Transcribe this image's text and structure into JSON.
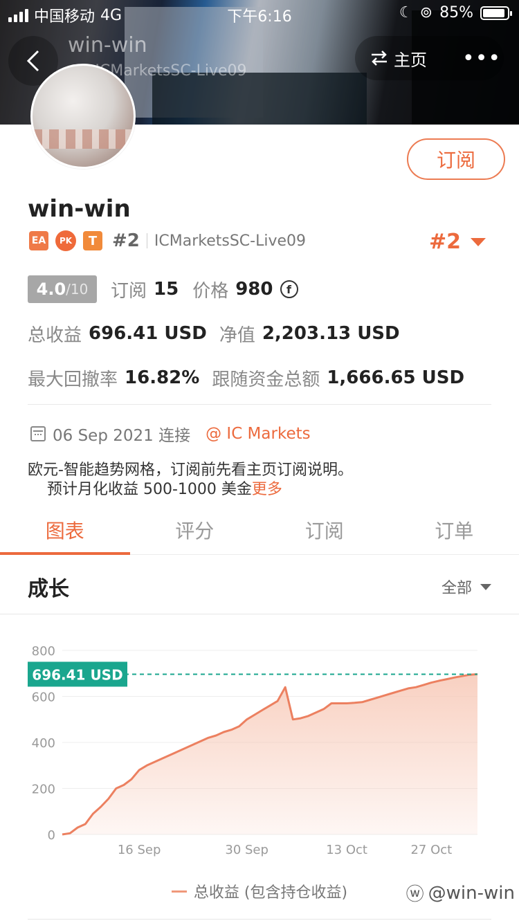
{
  "status_bar": {
    "carrier": "中国移动",
    "network": "4G",
    "time": "下午6:16",
    "battery": "85%"
  },
  "nav": {
    "title": "win-win",
    "subtitle": "#2 ICMarketsSC-Live09",
    "home_label": "主页",
    "more_label": "•••"
  },
  "profile": {
    "subscribe_label": "订阅",
    "name": "win-win",
    "badges": {
      "ea": "EA",
      "pk": "PK",
      "t": "T"
    },
    "rank": "#2",
    "server": "ICMarketsSC-Live09",
    "rank_right": "#2"
  },
  "stats": {
    "score": "4.0",
    "score_den": "/10",
    "subscribe_label": "订阅",
    "subscribe_value": "15",
    "price_label": "价格",
    "price_value": "980",
    "coin_symbol": "f",
    "total_profit_label": "总收益",
    "total_profit_value": "696.41 USD",
    "equity_label": "净值",
    "equity_value": "2,203.13 USD",
    "max_drawdown_label": "最大回撤率",
    "max_drawdown_value": "16.82%",
    "follow_funds_label": "跟随资金总额",
    "follow_funds_value": "1,666.65 USD"
  },
  "connection": {
    "date_text": "06 Sep 2021 连接",
    "broker": "@ IC Markets"
  },
  "description": {
    "line1": "欧元-智能趋势网格，订阅前先看主页订阅说明。",
    "line2": "预计月化收益 500-1000 美金",
    "more": "更多"
  },
  "tabs": [
    {
      "label": "图表",
      "active": true
    },
    {
      "label": "评分",
      "active": false
    },
    {
      "label": "订阅",
      "active": false
    },
    {
      "label": "订单",
      "active": false
    }
  ],
  "section": {
    "title": "成长",
    "range": "全部"
  },
  "chart_data": {
    "type": "area",
    "yticks": [
      "800",
      "600",
      "400",
      "200",
      "0"
    ],
    "ytick_values": [
      800,
      600,
      400,
      200,
      0
    ],
    "xtick_labels": [
      "16 Sep",
      "30 Sep",
      "13 Oct",
      "27 Oct"
    ],
    "xtick_days": [
      10,
      24,
      37,
      48
    ],
    "ylim": [
      0,
      800
    ],
    "xlim_days": [
      0,
      54
    ],
    "current_value_label": "696.41 USD",
    "current_value": 696.41,
    "legend": "总收益 (包含持仓收益)",
    "color_line": "#ec8060",
    "color_fill": "#f7c8b6",
    "color_marker": "#1aa68e",
    "x": [
      0,
      1,
      2,
      3,
      4,
      5,
      6,
      7,
      8,
      9,
      10,
      11,
      12,
      13,
      14,
      15,
      16,
      17,
      18,
      19,
      20,
      21,
      22,
      23,
      24,
      25,
      26,
      27,
      28,
      29,
      30,
      31,
      32,
      33,
      34,
      35,
      36,
      37,
      38,
      39,
      40,
      41,
      42,
      43,
      44,
      45,
      46,
      47,
      48,
      49,
      50,
      51,
      52,
      53,
      54
    ],
    "y": [
      0,
      5,
      30,
      45,
      90,
      120,
      155,
      200,
      215,
      240,
      280,
      300,
      315,
      330,
      345,
      360,
      375,
      390,
      405,
      420,
      430,
      445,
      455,
      470,
      500,
      520,
      540,
      560,
      580,
      640,
      500,
      505,
      515,
      530,
      545,
      570,
      570,
      570,
      572,
      575,
      585,
      595,
      605,
      615,
      625,
      635,
      640,
      650,
      660,
      668,
      675,
      682,
      688,
      694,
      696.41
    ]
  },
  "legend_label": "总收益 (包含持仓收益)",
  "watermark": "@win-win"
}
